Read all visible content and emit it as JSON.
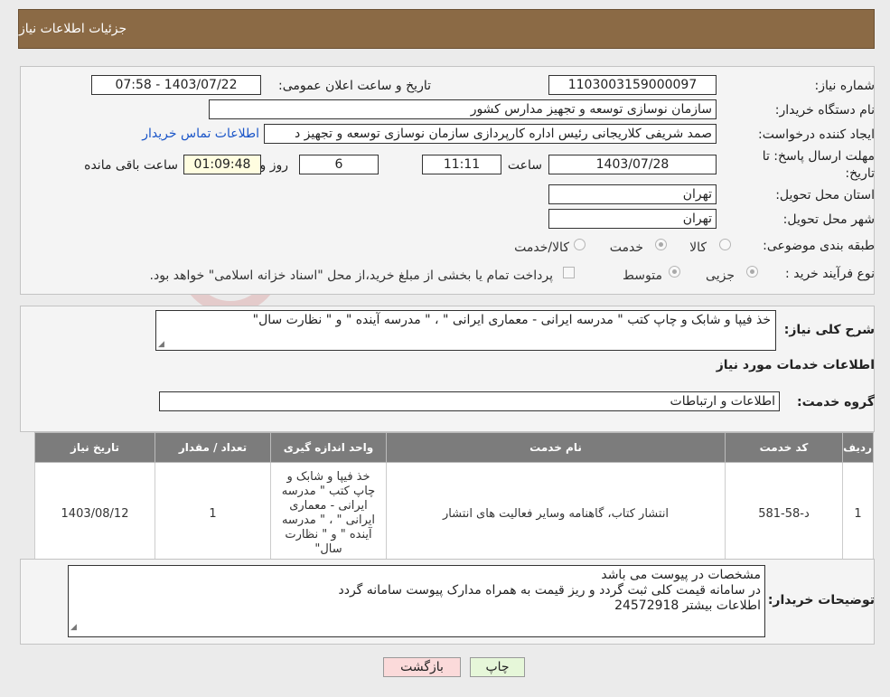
{
  "header": {
    "title": "جزئیات اطلاعات نیاز"
  },
  "form": {
    "need_number_label": "شماره نیاز:",
    "need_number": "1103003159000097",
    "announce_label": "تاریخ و ساعت اعلان عمومی:",
    "announce_value": "1403/07/22 - 07:58",
    "buyer_org_label": "نام دستگاه خریدار:",
    "buyer_org": "سازمان نوسازی  توسعه و تجهیز مدارس کشور",
    "requester_label": "ایجاد کننده درخواست:",
    "requester": "صمد شریفی کلاریجانی رئیس اداره کارپردازی سازمان نوسازی  توسعه و تجهیز د",
    "contact_link": "اطلاعات تماس خریدار",
    "deadline_label_1": "مهلت ارسال پاسخ: تا",
    "deadline_label_2": "تاریخ:",
    "deadline_date": "1403/07/28",
    "time_label": "ساعت",
    "deadline_time": "11:11",
    "days_value": "6",
    "days_label": "روز و",
    "remaining_time": "01:09:48",
    "remaining_label": "ساعت باقی مانده",
    "province_label": "استان محل تحویل:",
    "province": "تهران",
    "city_label": "شهر محل تحویل:",
    "city": "تهران",
    "category_label": "طبقه بندی موضوعی:",
    "category_options": [
      "کالا",
      "خدمت",
      "کالا/خدمت"
    ],
    "category_selected": "خدمت",
    "process_label": "نوع فرآیند خرید :",
    "process_options": [
      "جزیی",
      "متوسط"
    ],
    "payment_note": "پرداخت تمام یا بخشی از مبلغ خرید،از محل \"اسناد خزانه اسلامی\" خواهد بود."
  },
  "summary": {
    "label": "شرح کلی نیاز:",
    "text": "خذ فیپا و شابک و چاپ کتب \" مدرسه ایرانی - معماری ایرانی \" ، \" مدرسه آینده \" و \" نظارت سال\""
  },
  "services": {
    "section_title": "اطلاعات خدمات مورد نیاز",
    "group_label": "گروه خدمت:",
    "group_value": "اطلاعات و ارتباطات",
    "columns": [
      "ردیف",
      "کد خدمت",
      "نام خدمت",
      "واحد اندازه گیری",
      "تعداد / مقدار",
      "تاریخ نیاز"
    ],
    "rows": [
      {
        "row": "1",
        "code": "د-58-581",
        "name": "انتشار کتاب، گاهنامه وسایر فعالیت های انتشار",
        "unit": "خذ فیپا و شابک و چاپ کتب \" مدرسه ایرانی - معماری ایرانی \" ، \" مدرسه آینده \" و \" نظارت سال\"",
        "qty": "1",
        "date": "1403/08/12"
      }
    ]
  },
  "buyer_notes": {
    "label": "توضیحات خریدار:",
    "line1": "مشخصات در پیوست می باشد",
    "line2": "در سامانه قیمت کلی ثبت گردد و ریز قیمت به همراه مدارک پیوست سامانه گردد",
    "line3": "اطلاعات بیشتر 24572918"
  },
  "buttons": {
    "print": "چاپ",
    "back": "بازگشت"
  },
  "colors": {
    "header": "#8b6a45",
    "print_btn": "#e6f7d9",
    "back_btn": "#fbdada",
    "link": "#1a55c8"
  }
}
